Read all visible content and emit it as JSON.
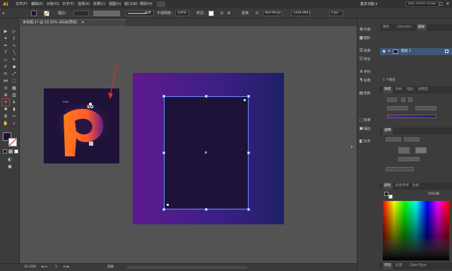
{
  "menubar": {
    "logo": "Ai",
    "items": [
      "文件(F)",
      "编辑(E)",
      "对象(O)",
      "文字(T)",
      "选择(S)",
      "效果(C)",
      "视图(V)",
      "窗口(W)",
      "帮助(H)"
    ],
    "workspace": "基本功能 ▾",
    "search_placeholder": "搜索 Adobe Stock",
    "window_buttons": [
      "—",
      "□",
      "✕"
    ]
  },
  "controlbar": {
    "stroke_label": "描边：",
    "brush_label": "基本",
    "opacity_label": "不透明度：",
    "opacity_value": "100%",
    "style_label": "样式：",
    "x_label": "X：",
    "x_value": "903.99 px",
    "y_value": "1104.094 px",
    "w_value": "0 px",
    "transform_label": "变换"
  },
  "document": {
    "tab_title": "未标题-1* @ 33.33% (RGB/预览)",
    "close": "✕"
  },
  "statusbar": {
    "zoom": "33.33%",
    "page": "1",
    "mode": "选择"
  },
  "dock": {
    "items": [
      {
        "icon": "✿",
        "label": "外观"
      },
      {
        "icon": "▦",
        "label": "图形"
      },
      {
        "icon": "☰",
        "label": "资源"
      },
      {
        "icon": "☷",
        "label": "符号"
      },
      {
        "icon": "A",
        "label": "字符"
      },
      {
        "icon": "¶",
        "label": "段落"
      },
      {
        "icon": "▤",
        "label": "变换"
      },
      {
        "icon": "⬚",
        "label": "资源"
      },
      {
        "icon": "▣",
        "label": "描边"
      },
      {
        "icon": "◧",
        "label": "对齐"
      }
    ]
  },
  "layers_panel": {
    "tabs": [
      "属性",
      "Libraries",
      "图层"
    ],
    "layer_name": "图层 1",
    "footer": "1 个图层"
  },
  "properties_panel": {
    "tabs": [
      "渐变",
      "色板",
      "描边",
      "透明度"
    ],
    "section": "透明",
    "tabs2": [
      "颜色",
      "颜色参考",
      "色板"
    ],
    "hex": "1f1238"
  },
  "bottom_tabs": [
    "字符",
    "段落",
    "OpenType"
  ],
  "colors": {
    "fill": "#1f1238",
    "artboard_start": "#5e1a8e",
    "artboard_end": "#1f2068",
    "selection": "#6b8cff",
    "accent_highlight": "#e03030"
  },
  "reference_art": {
    "text_top": "SO",
    "small_text": "Dark",
    "letter": "P"
  }
}
